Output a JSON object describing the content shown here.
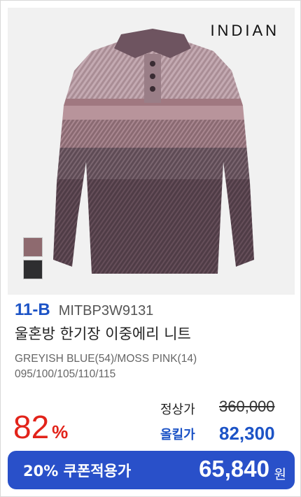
{
  "brand": "INDIAN",
  "product": {
    "code": "11-B",
    "sku": "MITBP3W9131",
    "title": "울혼방 한기장 이중에리 니트",
    "colors": "GREYISH BLUE(54)/MOSS PINK(14)",
    "sizes": "095/100/105/110/115"
  },
  "swatches": [
    {
      "name": "moss-pink",
      "color": "#8e6a6f"
    },
    {
      "name": "dark-grey",
      "color": "#2e2e30"
    }
  ],
  "pricing": {
    "discount_number": "82",
    "discount_symbol": "%",
    "regular_label": "정상가",
    "regular_price": "360,000",
    "sale_label": "올킬가",
    "sale_price": "82,300"
  },
  "coupon": {
    "label": "20% 쿠폰적용가",
    "price": "65,840",
    "unit": "원"
  },
  "colors": {
    "accent_blue": "#1c53c6",
    "coupon_bg": "#2950c9",
    "discount_red": "#e2231a"
  }
}
